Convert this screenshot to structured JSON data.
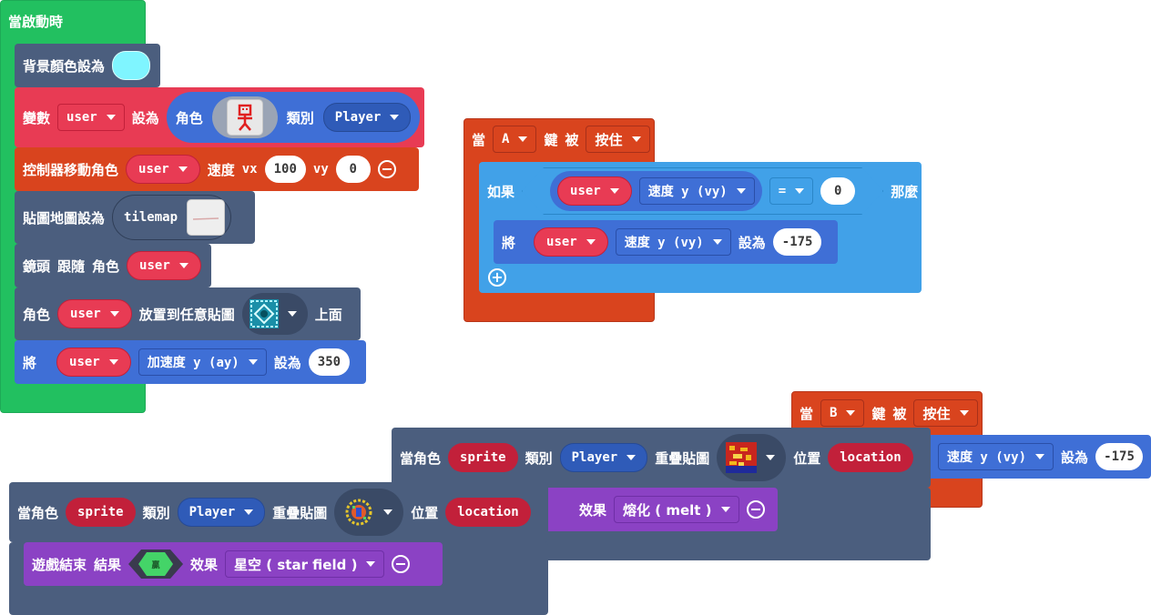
{
  "colors": {
    "event_green": "#22c060",
    "scene_navy": "#4b5e7e",
    "var_red": "#e83b54",
    "sprite_blue": "#3f6fd6",
    "controller_red": "#d9441e",
    "camera_red": "#e83b54",
    "logic_blue": "#41a1e8",
    "effect_purple": "#8b42c4",
    "on_key_orange": "#d9441e",
    "dropdown_dark": "#c2203a"
  },
  "on_start": {
    "hat": "當啟動時",
    "set_bg": {
      "label": "背景顏色設為",
      "color": "#7ff5ff"
    },
    "set_var": {
      "label": "變數",
      "var": "user",
      "set_label": "設為",
      "sprite_label": "角色",
      "kind_label": "類別",
      "kind": "Player"
    },
    "controller": {
      "label": "控制器移動角色",
      "var": "user",
      "speed_label": "速度",
      "vx_label": "vx",
      "vx": "100",
      "vy_label": "vy",
      "vy": "0"
    },
    "tilemap": {
      "label": "貼圖地圖設為",
      "value": "tilemap"
    },
    "camera": {
      "label1": "鏡頭",
      "label2": "跟隨",
      "label3": "角色",
      "var": "user"
    },
    "place": {
      "label1": "角色",
      "var": "user",
      "label2": "放置到任意貼圖",
      "label3": "上面"
    },
    "accel": {
      "label1": "將",
      "var": "user",
      "prop": "加速度 y (ay)",
      "set_label": "設為",
      "value": "350"
    }
  },
  "on_a": {
    "hat_prefix": "當",
    "key": "A",
    "mid1": "鍵",
    "mid2": "被",
    "event": "按住",
    "if_label": "如果",
    "then_label": "那麼",
    "cond": {
      "var": "user",
      "prop": "速度 y (vy)",
      "op": "=",
      "value": "0"
    },
    "set": {
      "label": "將",
      "var": "user",
      "prop": "速度 y (vy)",
      "set_label": "設為",
      "value": "-175"
    }
  },
  "on_b": {
    "hat_prefix": "當",
    "key": "B",
    "mid1": "鍵",
    "mid2": "被",
    "event": "按住",
    "set": {
      "prop": "速度 y (vy)",
      "set_label": "設為",
      "value": "-175"
    }
  },
  "overlap1": {
    "label1": "當角色",
    "var": "sprite",
    "kind_label": "類別",
    "kind": "Player",
    "overlap_label": "重疊貼圖",
    "loc_label": "位置",
    "loc": "location",
    "effect": {
      "label": "效果",
      "value": "熔化 ( melt )"
    }
  },
  "overlap2": {
    "label1": "當角色",
    "var": "sprite",
    "kind_label": "類別",
    "kind": "Player",
    "overlap_label": "重疊貼圖",
    "loc_label": "位置",
    "loc": "location",
    "gameover": {
      "label1": "遊戲結束",
      "label2": "結果",
      "win": "贏",
      "effect_label": "效果",
      "effect": "星空 ( star field )"
    }
  }
}
